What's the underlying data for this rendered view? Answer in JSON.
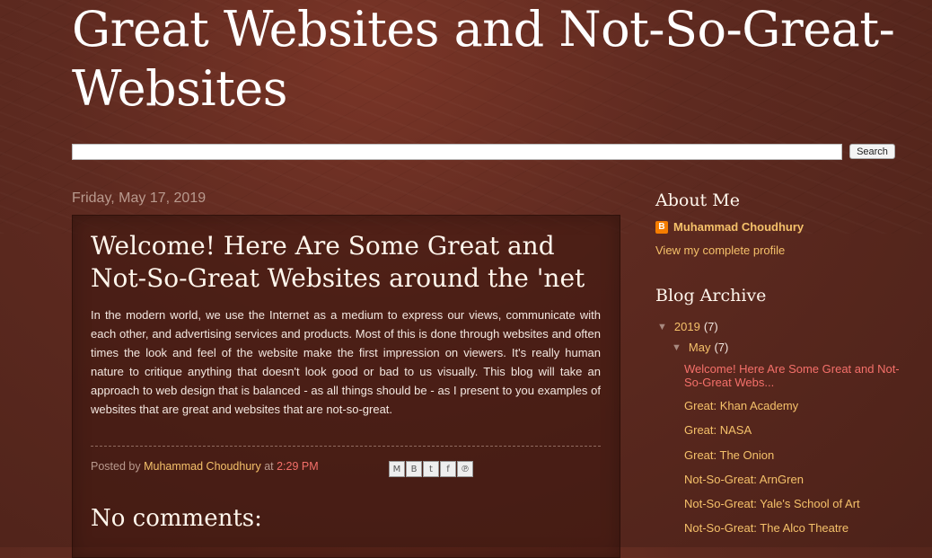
{
  "blog": {
    "title": "Great Websites and Not-So-Great-Websites"
  },
  "search": {
    "button_label": "Search",
    "value": ""
  },
  "post": {
    "date": "Friday, May 17, 2019",
    "title": "Welcome! Here Are Some Great and Not-So-Great Websites around the 'net",
    "body": "In the modern world, we use the Internet as a medium to express our views, communicate with each other, and advertising services and products. Most of this is done through websites and often times the look and feel of the website make the first impression on viewers. It's really human nature to critique anything that doesn't look good or bad to us visually. This blog will take an approach to web design that is balanced - as all things should be - as I present to you examples of websites that are great and websites that are not-so-great.",
    "posted_by_label": "Posted by",
    "author": "Muhammad Choudhury",
    "at_label": "at",
    "time": "2:29 PM",
    "share_icons": [
      "email-icon",
      "blogthis-icon",
      "twitter-icon",
      "facebook-icon",
      "pinterest-icon"
    ]
  },
  "comments": {
    "heading": "No comments:"
  },
  "sidebar": {
    "about": {
      "heading": "About Me",
      "name": "Muhammad Choudhury",
      "profile_link": "View my complete profile"
    },
    "archive": {
      "heading": "Blog Archive",
      "year": {
        "label": "2019",
        "count": "(7)"
      },
      "month": {
        "label": "May",
        "count": "(7)"
      },
      "posts": [
        "Welcome! Here Are Some Great and Not-So-Great Webs...",
        "Great: Khan Academy",
        "Great: NASA",
        "Great: The Onion",
        "Not-So-Great: ArnGren",
        "Not-So-Great: Yale's School of Art",
        "Not-So-Great: The Alco Theatre"
      ]
    }
  },
  "colors": {
    "link": "#f5c16a",
    "active_link": "#f5706a",
    "background": "#5e2a20"
  }
}
